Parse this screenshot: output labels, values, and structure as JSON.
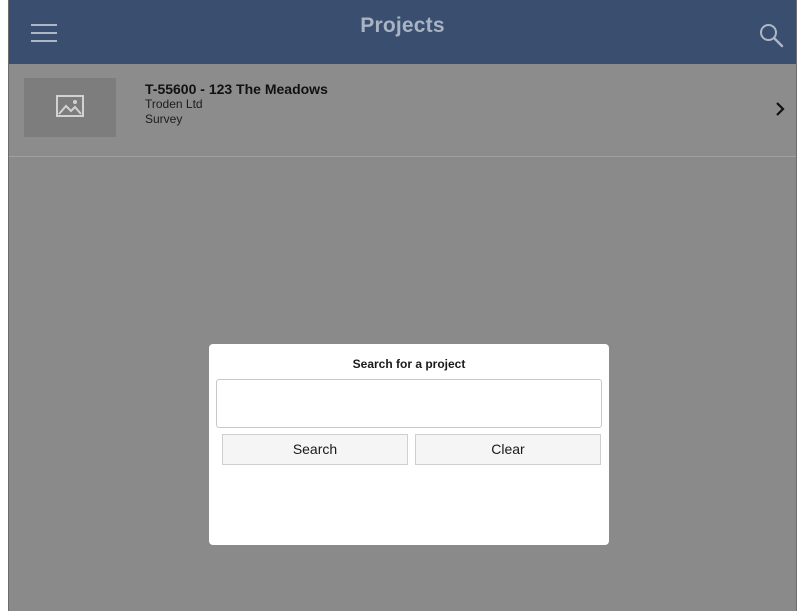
{
  "header": {
    "title": "Projects",
    "menu_icon": "hamburger-menu-icon",
    "search_icon": "search-icon"
  },
  "projects": [
    {
      "title": "T-55600 - 123 The Meadows",
      "company": "Troden Ltd",
      "type": "Survey",
      "thumbnail_icon": "image-placeholder-icon",
      "chevron_icon": "chevron-right-icon"
    }
  ],
  "search_dialog": {
    "title": "Search for a project",
    "input_value": "",
    "input_placeholder": "",
    "search_label": "Search",
    "clear_label": "Clear"
  },
  "colors": {
    "header_bg": "#3a4e70",
    "overlay_bg": "#8a8a8a",
    "dialog_bg": "#ffffff"
  }
}
